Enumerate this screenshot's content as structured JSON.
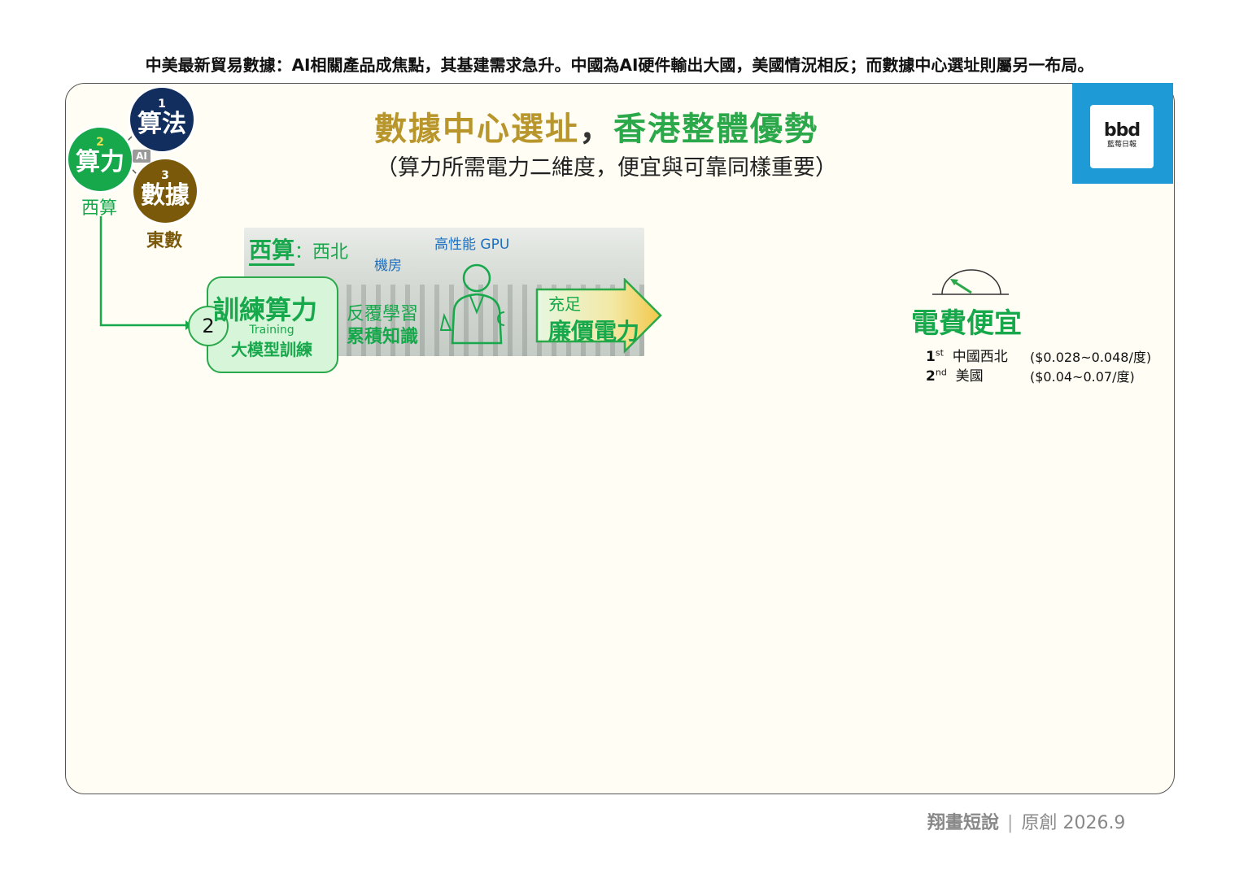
{
  "headline": "中美最新貿易數據：AI相關產品成焦點，其基建需求急升。中國為AI硬件輸出大國，美國情況相反；而數據中心選址則屬另一布局。",
  "title": {
    "part1": "數據中心選址",
    "sep": "，",
    "part2": "香港整體優勢"
  },
  "subtitle": "（算力所需電力二維度，便宜與可靠同樣重要）",
  "logo": {
    "mark": "bbd",
    "sub": "藍莓日報"
  },
  "circles": {
    "algo": {
      "num": "1",
      "label": "算法"
    },
    "power": {
      "num": "2",
      "label": "算力"
    },
    "data": {
      "num": "3",
      "label": "數據"
    },
    "ai_tag": "AI"
  },
  "labels": {
    "west": "西算",
    "east": "東數"
  },
  "west_block": {
    "title": "西算",
    "colon": "：",
    "region": "西北",
    "gpu": "高性能 GPU",
    "room": "機房"
  },
  "training": {
    "step": "2",
    "title": "訓練算力",
    "en": "Training",
    "zh": "大模型訓練"
  },
  "learning": {
    "line1": "反覆學習",
    "line2": "累積知識"
  },
  "power_arrow": {
    "line1": "充足",
    "line2": "廉價電力"
  },
  "cheap": {
    "title": "電費便宜",
    "ranks": [
      {
        "ord": "1",
        "sup": "st",
        "name": "中國西北",
        "price": "($0.028~0.048/度)"
      },
      {
        "ord": "2",
        "sup": "nd",
        "name": "美國",
        "price": "($0.04~0.07/度)"
      }
    ]
  },
  "footer": {
    "brand": "翔畫短說",
    "sep": "|",
    "label": "原創",
    "date": "2026.9"
  },
  "colors": {
    "green": "#17a84b",
    "gold": "#b8962c",
    "navy": "#122e5e",
    "brown": "#7a5a0a",
    "blue": "#1e9bd7"
  }
}
